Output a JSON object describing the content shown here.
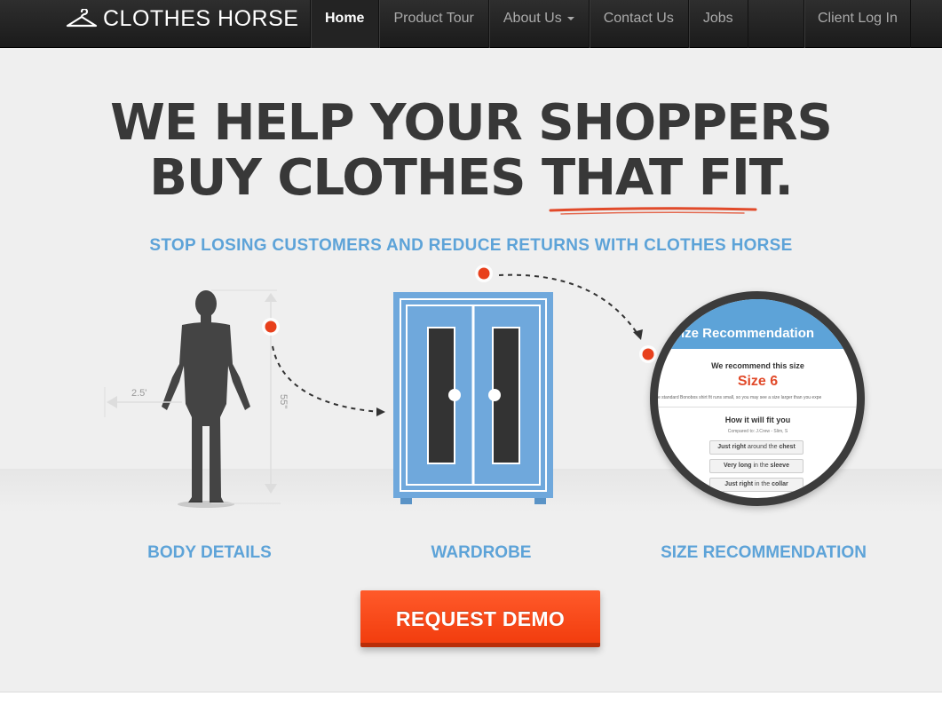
{
  "brand": {
    "name": "CLOTHES HORSE",
    "icon": "hanger-icon"
  },
  "nav": {
    "items": [
      {
        "label": "Home",
        "active": true
      },
      {
        "label": "Product Tour",
        "active": false
      },
      {
        "label": "About Us",
        "active": false,
        "dropdown": true
      },
      {
        "label": "Contact Us",
        "active": false
      },
      {
        "label": "Jobs",
        "active": false
      }
    ],
    "client_login": "Client Log In"
  },
  "hero": {
    "headline_line1": "WE HELP YOUR SHOPPERS",
    "headline_line2_plain": "BUY CLOTHES ",
    "headline_line2_underlined": "THAT FIT",
    "headline_line2_end": ".",
    "subhead": "STOP LOSING CUSTOMERS AND REDUCE RETURNS WITH CLOTHES HORSE"
  },
  "illustration": {
    "width_label": "2.5'",
    "height_label": "55\"",
    "magnifier": {
      "header": "Size Recommendation",
      "recommend_title": "We recommend this size",
      "size": "Size 6",
      "note": "e standard Bonobos shirt fit runs small, so you may see a size larger than you expe",
      "fit_title": "How it will fit you",
      "compared_to": "Compared to: J.Crew - Slim, S",
      "fit_rows": [
        {
          "pre": "Just right",
          "mid": " around the ",
          "post": "chest"
        },
        {
          "pre": "Very long",
          "mid": " in the ",
          "post": "sleeve"
        },
        {
          "pre": "Just right",
          "mid": " in the ",
          "post": "collar"
        }
      ]
    }
  },
  "steps": [
    "BODY DETAILS",
    "WARDROBE",
    "SIZE RECOMMENDATION"
  ],
  "cta": {
    "label": "REQUEST DEMO"
  },
  "colors": {
    "accent_blue": "#5da3d8",
    "accent_red": "#f23d0e",
    "dark_text": "#383838",
    "nav_bg": "#1f1f1f"
  }
}
